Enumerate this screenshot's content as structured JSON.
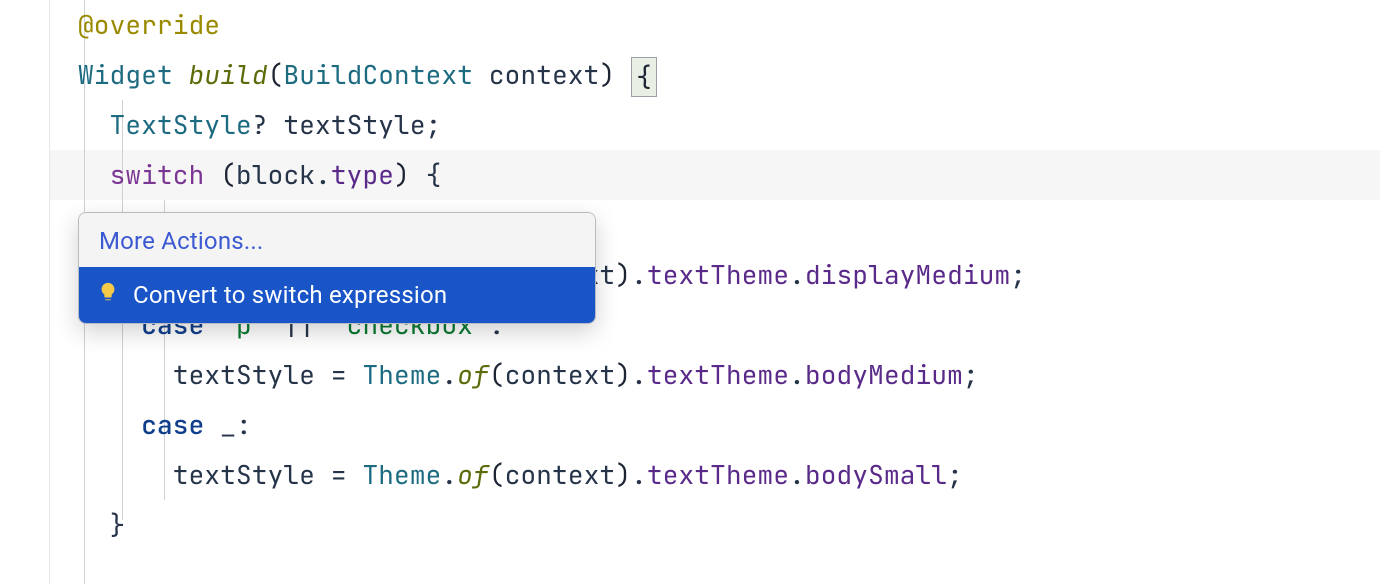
{
  "code": {
    "override_annotation": "@override",
    "widget_type": "Widget",
    "build_method": "build",
    "buildcontext_type": "BuildContext",
    "context_param": "context",
    "brace_open": "{",
    "textstyle_type": "TextStyle",
    "textstyle_qmark": "?",
    "textstyle_var": "textStyle",
    "semicolon": ";",
    "switch_kw": "switch",
    "block_ident": "block",
    "type_prop": "type",
    "paren_open": "(",
    "paren_close": ")",
    "brace_open2": "{",
    "dot": ".",
    "case_kw": "case",
    "underscore": "_",
    "colon": ":",
    "equals": "=",
    "theme_type": "Theme",
    "of_method": "of",
    "texttheme_prop": "textTheme",
    "display_medium": "displayMedium",
    "body_medium": "bodyMedium",
    "body_small": "bodySmall",
    "case_p_str": "'p'",
    "or_op": "||",
    "case_checkbox_str": "'checkbox'",
    "brace_close": "}",
    "f_context_frag": "f(context).textTheme.displayMedium;"
  },
  "popup": {
    "header": "More Actions...",
    "item": "Convert to switch expression"
  }
}
